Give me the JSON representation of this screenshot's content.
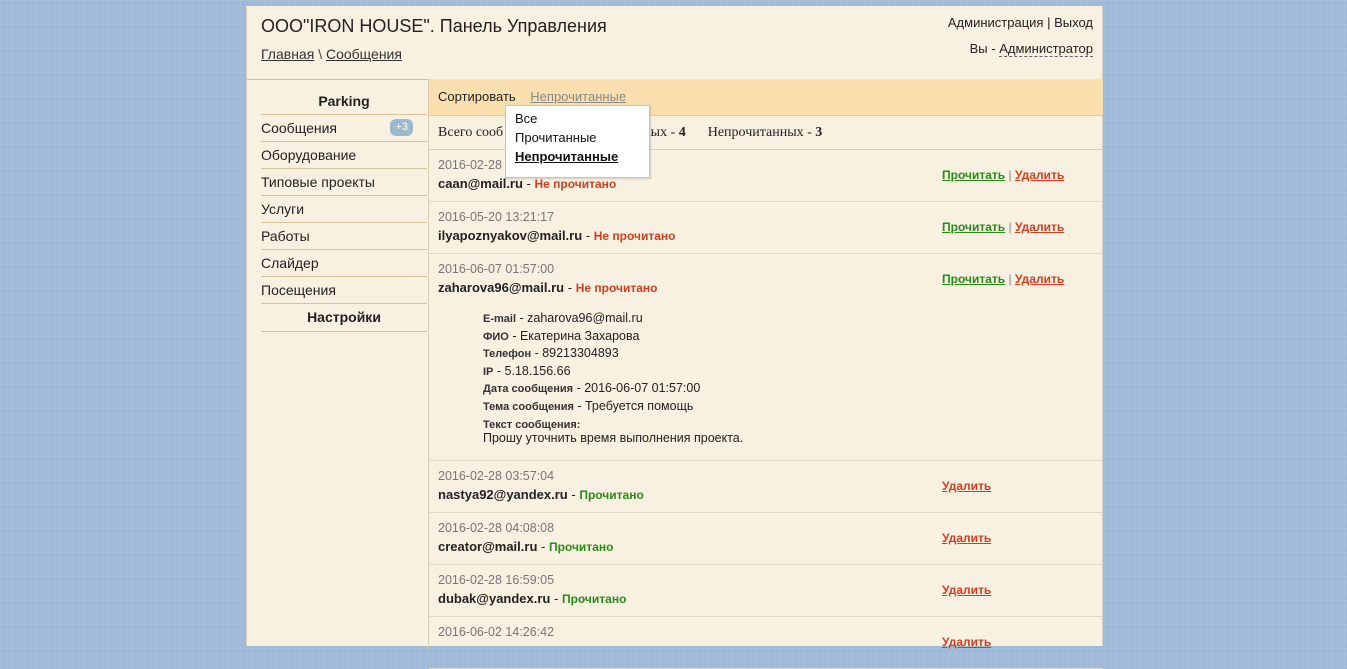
{
  "header": {
    "title": "ООО\"IRON HOUSE\". Панель Управления",
    "breadcrumb": {
      "home": "Главная",
      "separator": "\\",
      "current": "Сообщения"
    },
    "links": {
      "admin": "Администрация",
      "separator": "|",
      "logout": "Выход"
    },
    "user": {
      "prefix": "Вы -",
      "name": "Администратор"
    }
  },
  "sidebar": {
    "heading": "Parking",
    "items": [
      {
        "label": "Сообщения",
        "badge": "+3"
      },
      {
        "label": "Оборудование"
      },
      {
        "label": "Типовые проекты"
      },
      {
        "label": "Услуги"
      },
      {
        "label": "Работы"
      },
      {
        "label": "Слайдер"
      },
      {
        "label": "Посещения"
      }
    ],
    "settings": "Настройки"
  },
  "sort": {
    "label": "Сортировать",
    "current": "Непрочитанные",
    "options": [
      "Все",
      "Прочитанные",
      "Непрочитанные"
    ]
  },
  "summary": {
    "total_prefix": "Всего сооб",
    "read_tail": "ных - ",
    "read_count": "4",
    "unread_label": "Непрочитанных - ",
    "unread_count": "3"
  },
  "actions": {
    "read": "Прочитать",
    "delete": "Удалить",
    "separator": "|"
  },
  "messages": [
    {
      "date": "2016-02-28",
      "email": "caan@mail.ru",
      "status": "Не прочитано"
    },
    {
      "date": "2016-05-20 13:21:17",
      "email": "ilyapoznyakov@mail.ru",
      "status": "Не прочитано"
    },
    {
      "date": "2016-06-07 01:57:00",
      "email": "zaharova96@mail.ru",
      "status": "Не прочитано",
      "details": {
        "email_label": "E-mail",
        "email": "zaharova96@mail.ru",
        "fio_label": "ФИО",
        "fio": "Екатерина Захарова",
        "phone_label": "Телефон",
        "phone": "89213304893",
        "ip_label": "IP",
        "ip": "5.18.156.66",
        "date_label": "Дата сообщения",
        "date": "2016-06-07 01:57:00",
        "subject_label": "Тема сообщения",
        "subject": "Требуется помощь",
        "text_label": "Текст сообщения:",
        "text": "Прошу уточнить время выполнения проекта."
      }
    },
    {
      "date": "2016-02-28 03:57:04",
      "email": "nastya92@yandex.ru",
      "status": "Прочитано"
    },
    {
      "date": "2016-02-28 04:08:08",
      "email": "creator@mail.ru",
      "status": "Прочитано"
    },
    {
      "date": "2016-02-28 16:59:05",
      "email": "dubak@yandex.ru",
      "status": "Прочитано"
    },
    {
      "date": "2016-06-02 14:26:42",
      "email": "",
      "status": ""
    }
  ]
}
